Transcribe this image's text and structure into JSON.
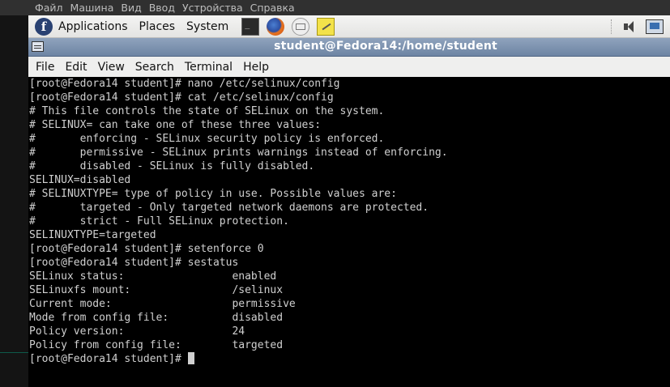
{
  "host_menu": [
    "Файл",
    "Машина",
    "Вид",
    "Ввод",
    "Устройства",
    "Справка"
  ],
  "panel": {
    "menus": [
      "Applications",
      "Places",
      "System"
    ],
    "logo_glyph": "f"
  },
  "terminal": {
    "title": "student@Fedora14:/home/student",
    "menu": [
      "File",
      "Edit",
      "View",
      "Search",
      "Terminal",
      "Help"
    ],
    "lines": [
      "[root@Fedora14 student]# nano /etc/selinux/config",
      "[root@Fedora14 student]# cat /etc/selinux/config",
      "# This file controls the state of SELinux on the system.",
      "# SELINUX= can take one of these three values:",
      "#       enforcing - SELinux security policy is enforced.",
      "#       permissive - SELinux prints warnings instead of enforcing.",
      "#       disabled - SELinux is fully disabled.",
      "SELINUX=disabled",
      "# SELINUXTYPE= type of policy in use. Possible values are:",
      "#       targeted - Only targeted network daemons are protected.",
      "#       strict - Full SELinux protection.",
      "SELINUXTYPE=targeted",
      "[root@Fedora14 student]# setenforce 0",
      "[root@Fedora14 student]# sestatus",
      "SELinux status:                 enabled",
      "SELinuxfs mount:                /selinux",
      "Current mode:                   permissive",
      "Mode from config file:          disabled",
      "Policy version:                 24",
      "Policy from config file:        targeted"
    ],
    "prompt": "[root@Fedora14 student]# "
  },
  "colors": {
    "title_bar": "#7d92b0",
    "terminal_bg": "#000000",
    "terminal_fg": "#d0d0d0"
  }
}
